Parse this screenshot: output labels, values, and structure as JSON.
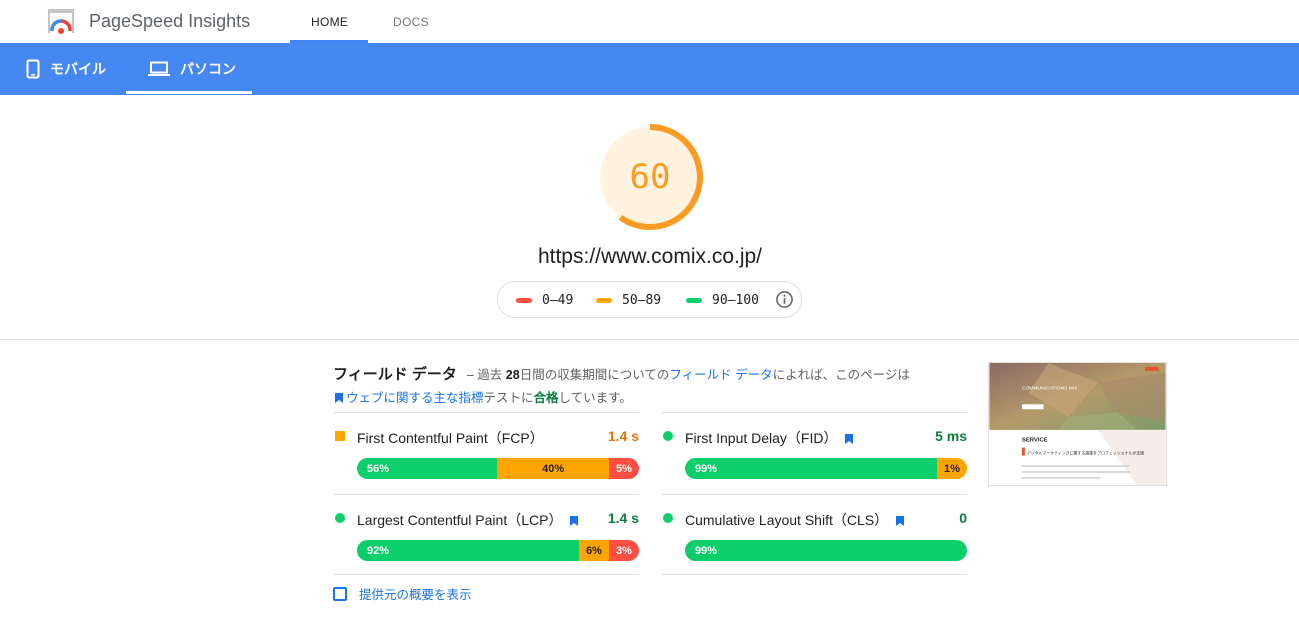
{
  "app": {
    "title": "PageSpeed Insights"
  },
  "nav": {
    "home": "HOME",
    "docs": "DOCS"
  },
  "device_tabs": {
    "mobile": "モバイル",
    "desktop": "パソコン"
  },
  "score": {
    "value": "60",
    "fraction": 0.6,
    "color": "#fa9b23"
  },
  "url": "https://www.comix.co.jp/",
  "legend": [
    {
      "label": "0–49",
      "color": "#ff4e42"
    },
    {
      "label": "50–89",
      "color": "#ffa400"
    },
    {
      "label": "90–100",
      "color": "#0cce6b"
    }
  ],
  "field_data": {
    "title": "フィールド データ",
    "desc_1": "– 過去",
    "days": "28",
    "desc_2": "日間の収集期間についての",
    "link_field": "フィールド データ",
    "desc_3": "によれば、このページは",
    "link_vitals": "ウェブに関する主な指標",
    "desc_4": "テストに",
    "passed": "合格",
    "desc_5": "しています。"
  },
  "metrics": {
    "fcp": {
      "label": "First Contentful Paint（FCP）",
      "value": "1.4 s",
      "good": "56%",
      "ni": "40%",
      "poor": "5%",
      "g": 56,
      "o": 40,
      "r": 5
    },
    "fid": {
      "label": "First Input Delay（FID）",
      "value": "5 ms",
      "good": "99%",
      "ni": "1%",
      "g": 99,
      "o": 1,
      "r": 0
    },
    "lcp": {
      "label": "Largest Contentful Paint（LCP）",
      "value": "1.4 s",
      "good": "92%",
      "ni": "6%",
      "poor": "3%",
      "g": 92,
      "o": 6,
      "r": 3
    },
    "cls": {
      "label": "Cumulative Layout Shift（CLS）",
      "value": "0",
      "good": "99%",
      "g": 99,
      "o": 0,
      "r": 0
    }
  },
  "summary_label": "提供元の概要を表示",
  "thumbnail": {
    "heading": "COMMUNICATIONS MIX",
    "section": "SERVICE",
    "caption": "デジタルマーケティングに関する施策をプロフェッショナルが支援"
  },
  "colors": {
    "accent": "#4688f1",
    "good": "#0cce6b",
    "average": "#ffa400",
    "poor": "#ff4e42",
    "link": "#1a73e8"
  }
}
